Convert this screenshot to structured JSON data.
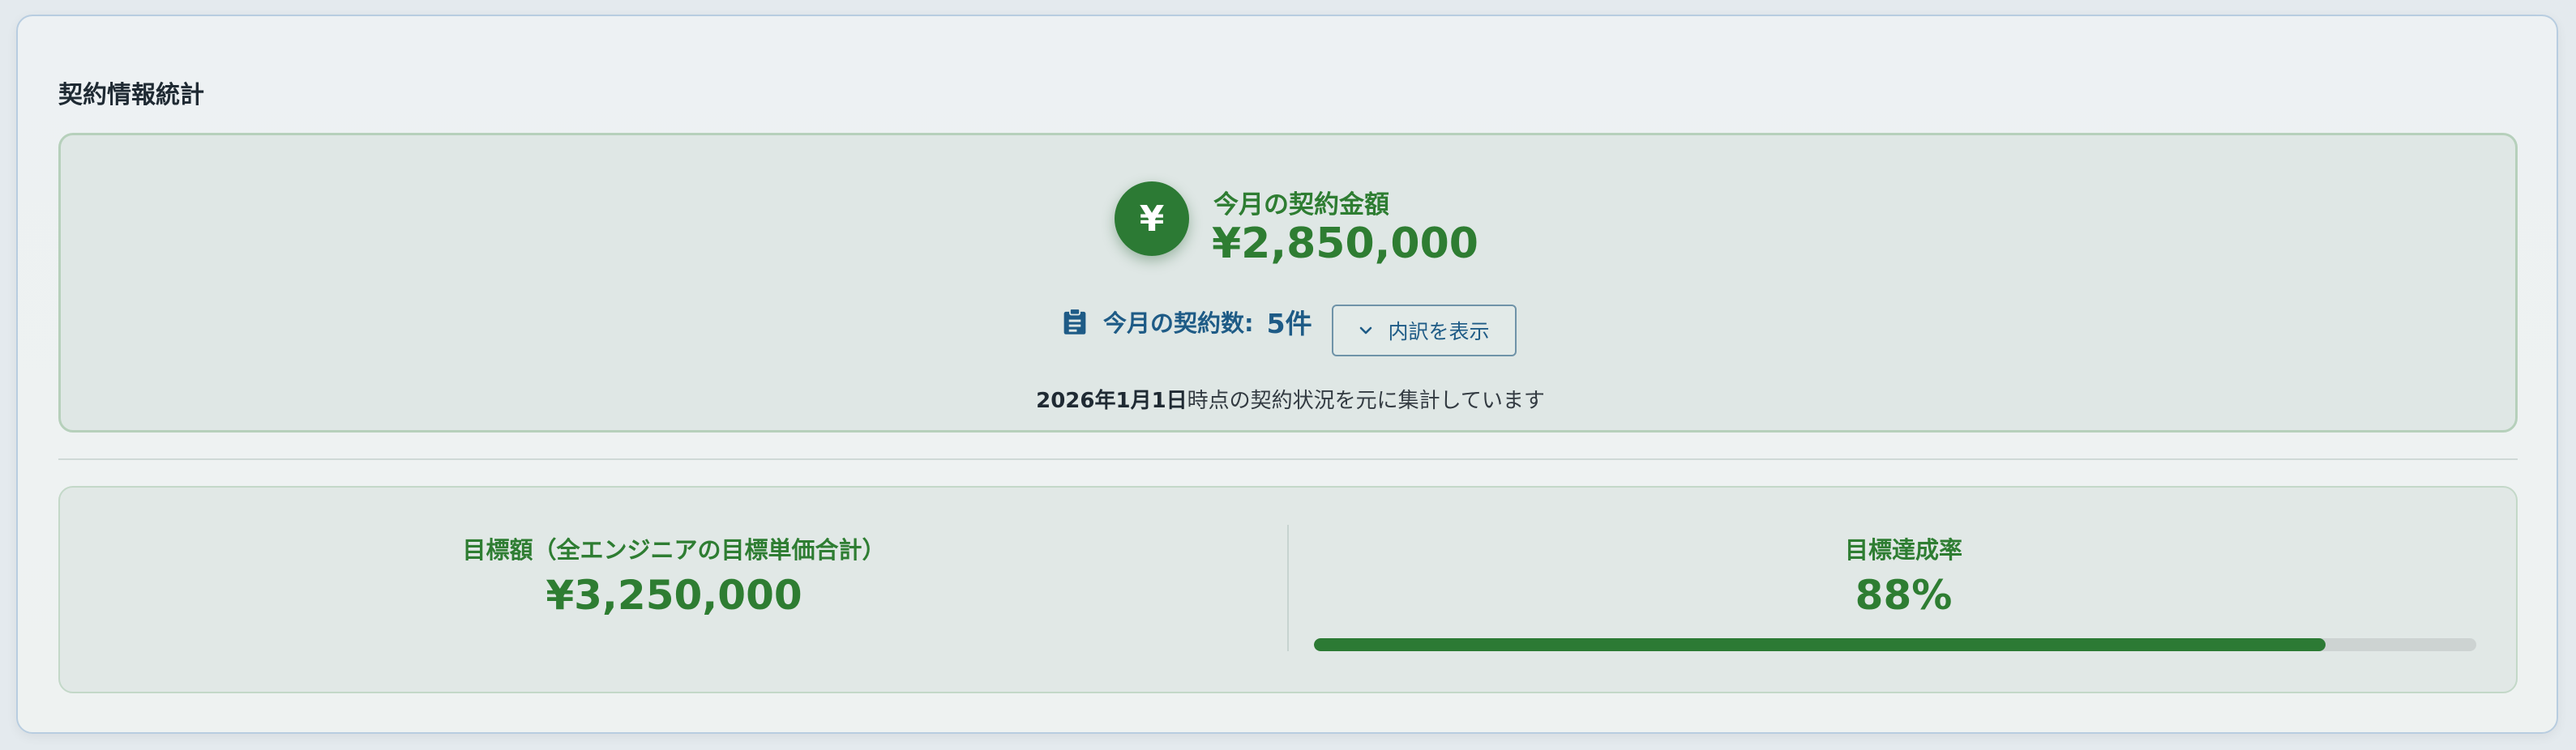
{
  "panel": {
    "title": "契約情報統計"
  },
  "summary": {
    "yen_icon": "yen-icon",
    "yen_glyph": "¥",
    "amount_label": "今月の契約金額",
    "amount_value": "¥2,850,000",
    "count_icon": "clipboard-icon",
    "count_label": "今月の契約数:",
    "count_value": "5件",
    "breakdown_button_label": "内訳を表示",
    "as_of_date": "2026年1月1日",
    "as_of_suffix": "時点の契約状況を元に集計しています"
  },
  "goals": {
    "target_label": "目標額（全エンジニアの目標単価合計）",
    "target_value": "¥3,250,000",
    "rate_label": "目標達成率",
    "rate_value": "88%",
    "rate_progress_percent": 87
  },
  "colors": {
    "accent_green": "#2e7d32",
    "accent_blue": "#1e5b86"
  }
}
